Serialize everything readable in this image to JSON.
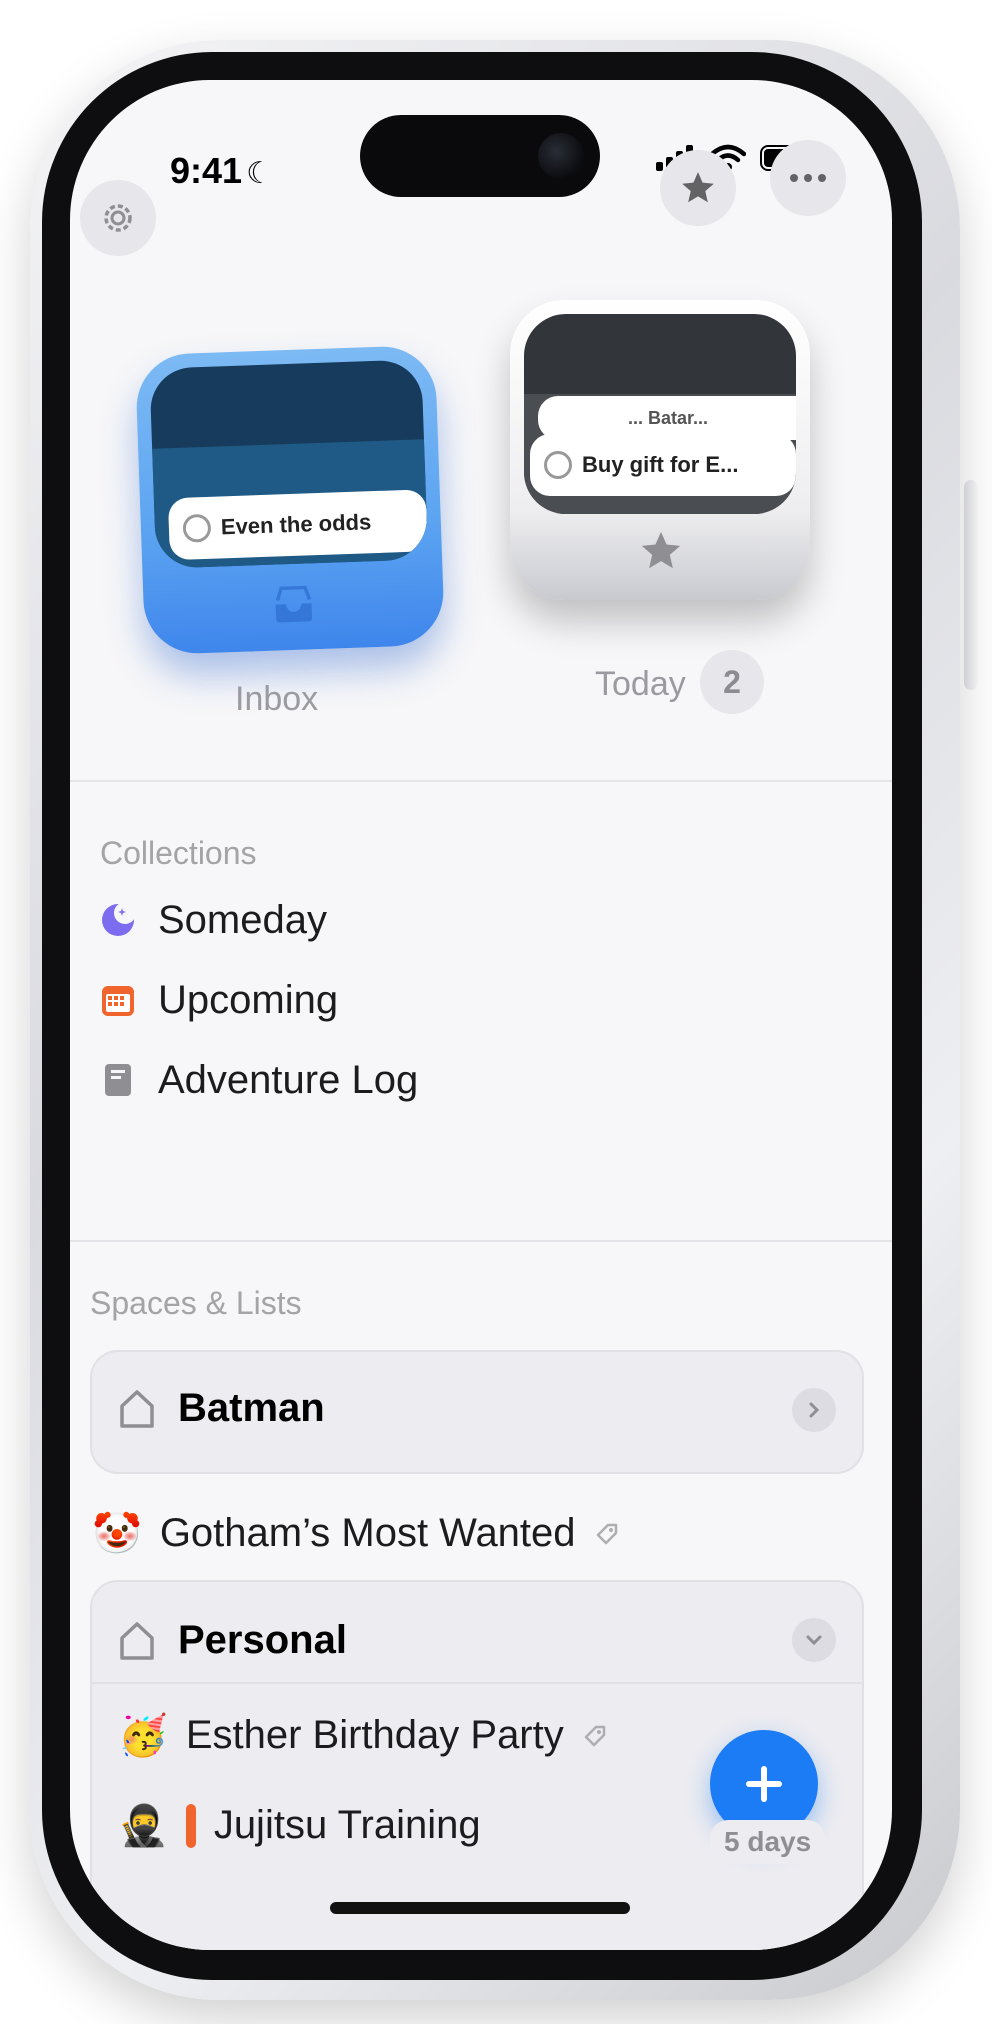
{
  "status_bar": {
    "time": "9:41"
  },
  "tiles": {
    "inbox": {
      "preview_task": "Even the odds",
      "label": "Inbox",
      "accent": "#5ba3f1"
    },
    "today": {
      "preview_task": "Buy gift for E...",
      "preview_task_behind": "... Batar...",
      "label": "Today",
      "count": "2"
    }
  },
  "collections": {
    "title": "Collections",
    "items": [
      {
        "label": "Someday",
        "icon": "moon-icon",
        "color": "#7b6cf0"
      },
      {
        "label": "Upcoming",
        "icon": "calendar-icon",
        "color": "#f0642d"
      },
      {
        "label": "Adventure Log",
        "icon": "book-icon",
        "color": "#8e8e93"
      }
    ]
  },
  "spaces": {
    "title": "Spaces & Lists",
    "batman": {
      "label": "Batman"
    },
    "gotham": {
      "emoji": "🤡",
      "label": "Gotham’s Most Wanted"
    },
    "personal": {
      "label": "Personal",
      "lists": [
        {
          "emoji": "🥳",
          "label": "Esther Birthday Party"
        },
        {
          "emoji": "🥷",
          "label": "Jujitsu Training",
          "due": "5 days"
        }
      ]
    }
  },
  "colors": {
    "fab": "#1b7cf5",
    "background": "#f7f7f9"
  }
}
